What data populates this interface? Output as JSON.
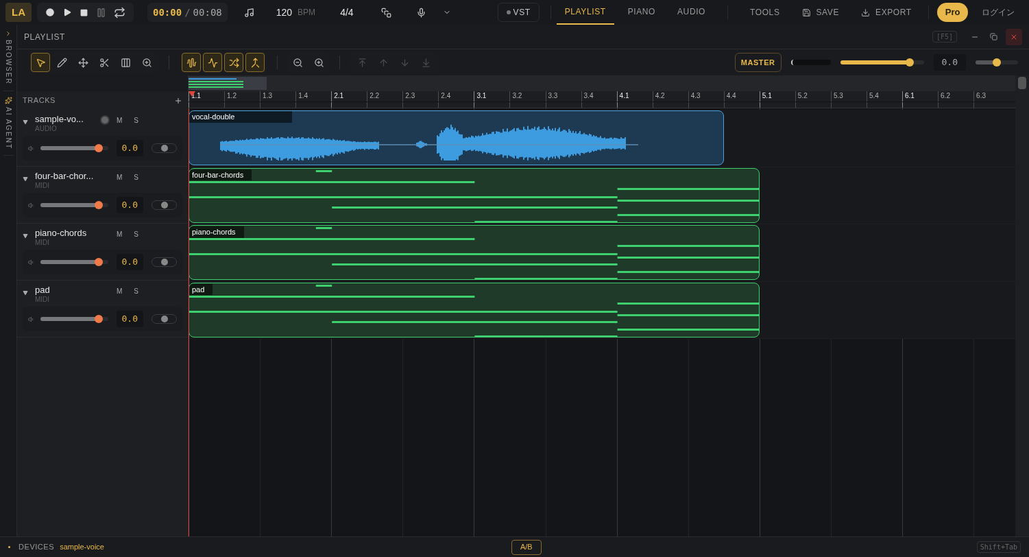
{
  "logo": "LA",
  "time": {
    "current": "00:00",
    "separator": "/",
    "total": "00:08"
  },
  "tempo": {
    "value": "120",
    "unit": "BPM"
  },
  "meter": "4/4",
  "vst": "VST",
  "tabs": [
    {
      "label": "PLAYLIST",
      "selected": true
    },
    {
      "label": "PIANO",
      "selected": false
    },
    {
      "label": "AUDIO",
      "selected": false
    }
  ],
  "actions": [
    {
      "kind": "plain",
      "label": "TOOLS"
    },
    {
      "kind": "save",
      "label": "SAVE"
    },
    {
      "kind": "export",
      "label": "EXPORT"
    }
  ],
  "pro": "Pro",
  "login": "ログイン",
  "side_tabs": [
    {
      "kind": "browser",
      "label": "BROWSER"
    },
    {
      "kind": "agent",
      "label": "AI AGENT"
    }
  ],
  "panel": {
    "title": "PLAYLIST",
    "shortcut": "[F5]"
  },
  "edit_tools": [
    {
      "kind": "select",
      "selected": true
    },
    {
      "kind": "pencil",
      "selected": false
    },
    {
      "kind": "move",
      "selected": false
    },
    {
      "kind": "cut",
      "selected": false
    },
    {
      "kind": "slice",
      "selected": false
    },
    {
      "kind": "zoom",
      "selected": false
    }
  ],
  "snap_tools": [
    {
      "kind": "wave",
      "on": true
    },
    {
      "kind": "pulse",
      "on": true
    },
    {
      "kind": "stretch",
      "on": true
    },
    {
      "kind": "merge",
      "on": true
    }
  ],
  "order_tools": [
    {
      "kind": "top",
      "disabled": true
    },
    {
      "kind": "up",
      "disabled": true
    },
    {
      "kind": "down",
      "disabled": true
    },
    {
      "kind": "bottom",
      "disabled": true
    }
  ],
  "master": {
    "label": "MASTER",
    "level": 0.83,
    "reading": "0.0",
    "pan": {
      "level": 0.5
    }
  },
  "tracks_header": "TRACKS",
  "ruler": [
    "1.1",
    "1.2",
    "1.3",
    "1.4",
    "2.1",
    "2.2",
    "2.3",
    "2.4",
    "3.1",
    "3.2",
    "3.3",
    "3.4",
    "4.1",
    "4.2",
    "4.3",
    "4.4",
    "5.1",
    "5.2",
    "5.3",
    "5.4",
    "6.1",
    "6.2",
    "6.3"
  ],
  "tracks": [
    {
      "name": "sample-vo...",
      "type": "AUDIO",
      "kind": "audio",
      "mute": "M",
      "solo": "S",
      "level": 0.86,
      "reading": "0.0",
      "pan": {
        "level": 0.5
      },
      "clip": "vocal-double"
    },
    {
      "name": "four-bar-chor...",
      "type": "MIDI",
      "kind": "midi",
      "mute": "M",
      "solo": "S",
      "level": 0.86,
      "reading": "0.0",
      "pan": {
        "level": 0.5
      },
      "clip": "four-bar-chords"
    },
    {
      "name": "piano-chords",
      "type": "MIDI",
      "kind": "midi",
      "mute": "M",
      "solo": "S",
      "level": 0.86,
      "reading": "0.0",
      "pan": {
        "level": 0.5
      },
      "clip": "piano-chords"
    },
    {
      "name": "pad",
      "type": "MIDI",
      "kind": "midi",
      "mute": "M",
      "solo": "S",
      "level": 0.86,
      "reading": "0.0",
      "pan": {
        "level": 0.5
      },
      "clip": "pad"
    }
  ],
  "status": {
    "label": "DEVICES",
    "device": "sample-voice",
    "ab": "A/B",
    "shortcut": "Shift+Tab"
  }
}
